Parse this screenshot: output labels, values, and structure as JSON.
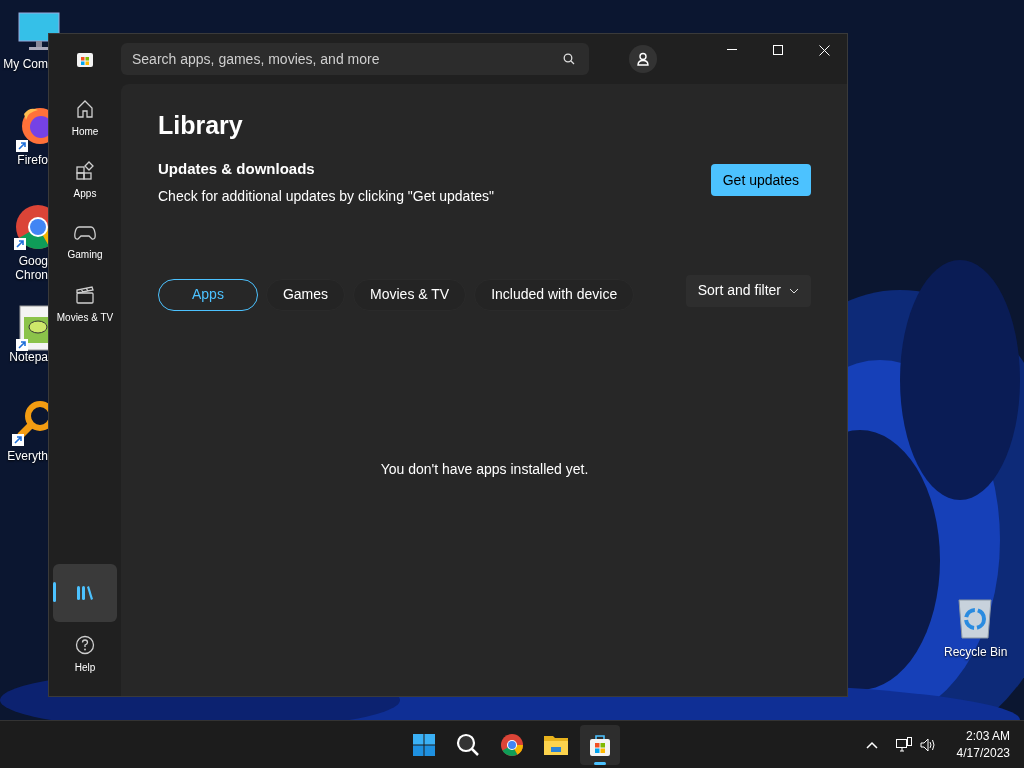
{
  "desktop_icons": [
    {
      "kind": "monitor",
      "lines": [
        "My Com"
      ]
    },
    {
      "kind": "firefox",
      "lines": [
        "Firefo"
      ]
    },
    {
      "kind": "chrome",
      "lines": [
        "Goog",
        "Chron"
      ]
    },
    {
      "kind": "notepad",
      "lines": [
        "Notepa"
      ]
    },
    {
      "kind": "everything",
      "lines": [
        "Everyth"
      ]
    },
    {
      "kind": "recycle",
      "lines": [
        "Recycle Bin"
      ]
    }
  ],
  "window": {
    "search": {
      "placeholder": "Search apps, games, movies, and more"
    },
    "nav": [
      {
        "kind": "home",
        "label": "Home",
        "selected": false
      },
      {
        "kind": "apps",
        "label": "Apps",
        "selected": false
      },
      {
        "kind": "gaming",
        "label": "Gaming",
        "selected": false
      },
      {
        "kind": "movies",
        "label": "Movies & TV",
        "selected": false
      },
      {
        "kind": "library",
        "selected": true
      },
      {
        "kind": "help",
        "label": "Help",
        "selected": false
      }
    ],
    "page": {
      "title": "Library",
      "section_title": "Updates & downloads",
      "description": "Check for additional updates by clicking \"Get updates\"",
      "button": "Get updates",
      "filters": [
        {
          "label": "Apps",
          "selected": true
        },
        {
          "label": "Games",
          "selected": false
        },
        {
          "label": "Movies & TV",
          "selected": false
        },
        {
          "label": "Included with device",
          "selected": false
        }
      ],
      "sort": "Sort and filter",
      "empty_message": "You don't have apps installed yet."
    }
  },
  "taskbar": {
    "apps": [
      {
        "kind": "start",
        "selected": false
      },
      {
        "kind": "search",
        "selected": false
      },
      {
        "kind": "chrome",
        "selected": false
      },
      {
        "kind": "explorer",
        "selected": false
      },
      {
        "kind": "store",
        "selected": true
      }
    ],
    "time": "2:03 AM",
    "date": "4/17/2023"
  }
}
